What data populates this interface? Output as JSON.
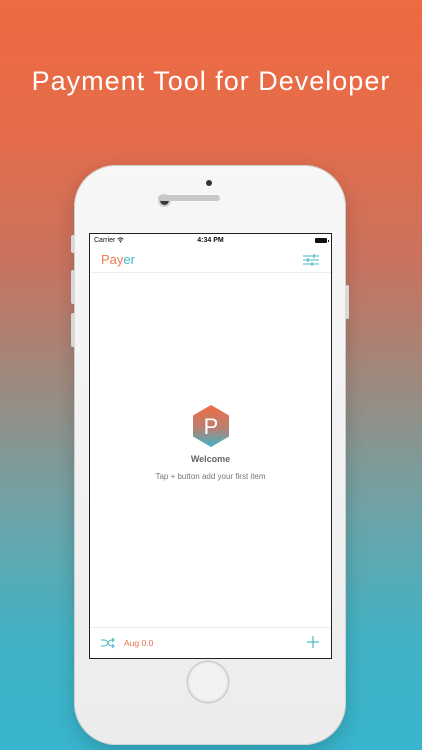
{
  "headline": "Payment Tool for Developer",
  "status_bar": {
    "carrier": "Carrier",
    "time": "4:34 PM"
  },
  "app": {
    "title_part1": "Pay",
    "title_part2": "er"
  },
  "empty_state": {
    "logo_letter": "P",
    "title": "Welcome",
    "subtitle": "Tap + button add your first item"
  },
  "toolbar": {
    "version_label": "Aug 0.0"
  },
  "colors": {
    "accent_orange": "#e9734f",
    "accent_teal": "#47b6c8"
  },
  "icons": [
    "wifi-icon",
    "battery-icon",
    "settings-sliders-icon",
    "hexagon-logo-icon",
    "shuffle-icon",
    "plus-icon"
  ]
}
